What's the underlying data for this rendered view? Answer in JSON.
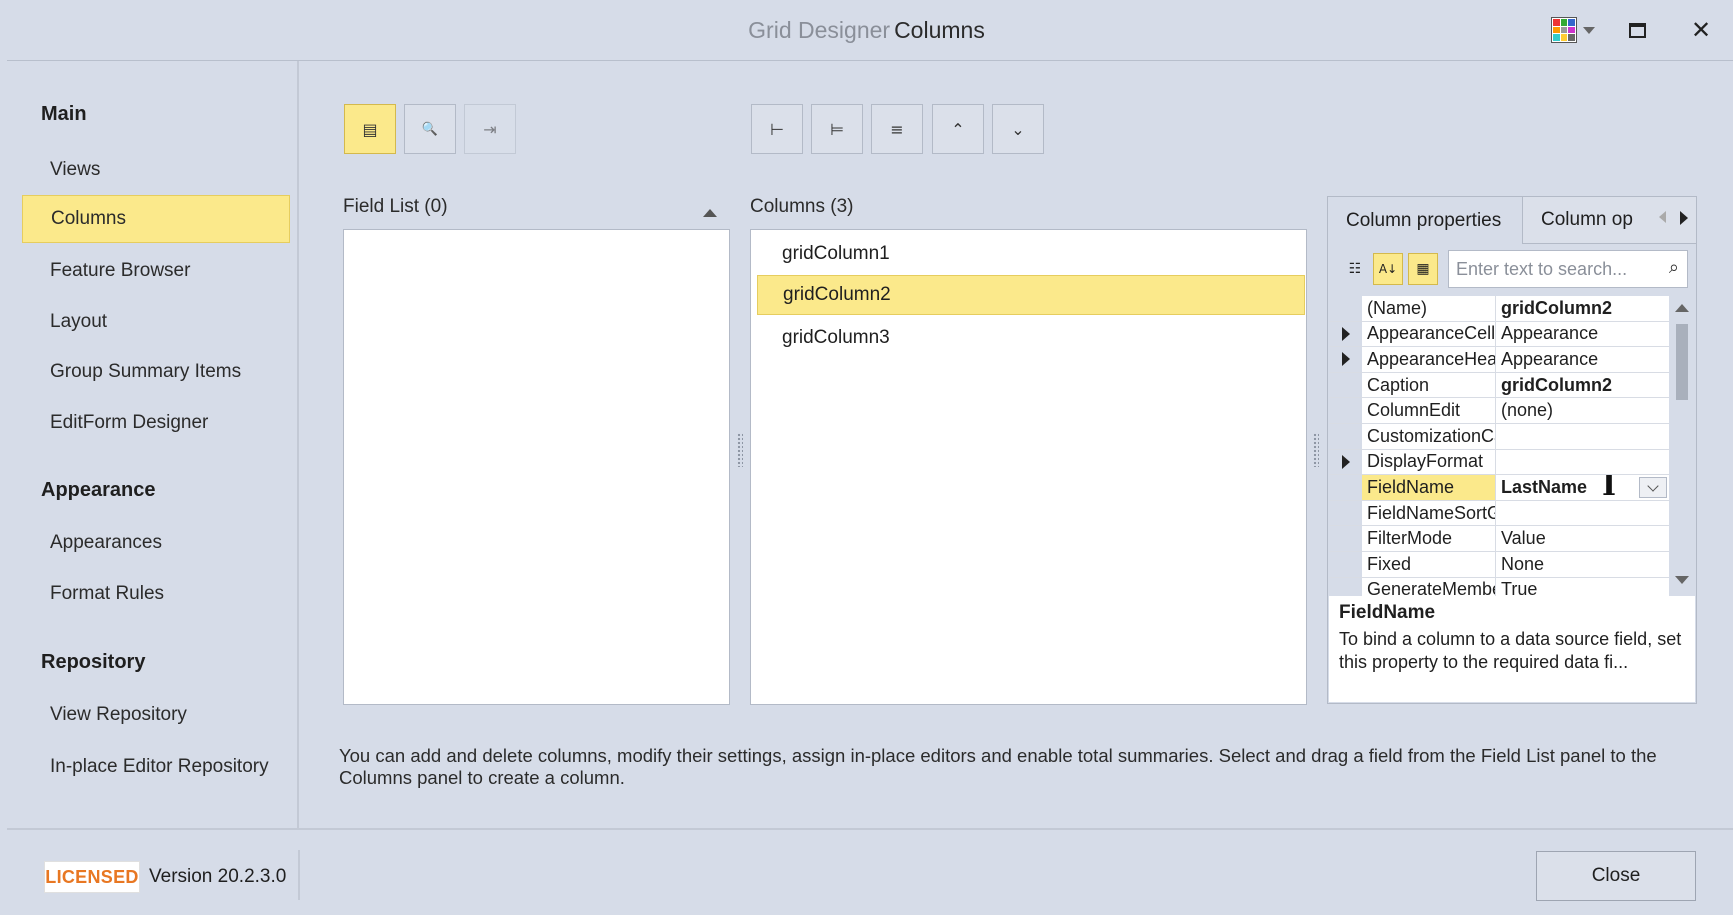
{
  "window": {
    "title_prefix": "Grid Designer",
    "title_page": "Columns",
    "controls": {
      "skin_icon": "skin-palette-icon",
      "maximize_icon": "maximize-icon",
      "close_label": "✕"
    }
  },
  "sidebar": {
    "groups": [
      {
        "label": "Main",
        "items": [
          "Views",
          "Columns",
          "Feature Browser",
          "Layout",
          "Group Summary Items",
          "EditForm Designer"
        ]
      },
      {
        "label": "Appearance",
        "items": [
          "Appearances",
          "Format Rules"
        ]
      },
      {
        "label": "Repository",
        "items": [
          "View Repository",
          "In-place Editor Repository"
        ]
      }
    ],
    "active_item": "Columns"
  },
  "toolbar": {
    "left_buttons": [
      {
        "name": "show-field-list",
        "icon": "field-list-icon",
        "glyph": "▤"
      },
      {
        "name": "find-fields",
        "icon": "search-icon",
        "glyph": "🔍"
      },
      {
        "name": "retrieve-fields",
        "icon": "retrieve-fields-icon",
        "glyph": "⇥"
      }
    ],
    "right_buttons": [
      {
        "name": "add-column",
        "icon": "add-column-icon",
        "glyph": "⊢"
      },
      {
        "name": "insert-column",
        "icon": "insert-column-icon",
        "glyph": "⊨"
      },
      {
        "name": "remove-column",
        "icon": "remove-column-icon",
        "glyph": "≡"
      },
      {
        "name": "move-up",
        "icon": "chevron-up-icon",
        "glyph": "⌃"
      },
      {
        "name": "move-down",
        "icon": "chevron-down-icon",
        "glyph": "⌄"
      }
    ]
  },
  "field_list": {
    "title": "Field List (0)",
    "items": []
  },
  "columns": {
    "title": "Columns (3)",
    "items": [
      "gridColumn1",
      "gridColumn2",
      "gridColumn3"
    ],
    "selected": "gridColumn2"
  },
  "properties": {
    "tabs": [
      "Column properties",
      "Column op"
    ],
    "search_placeholder": "Enter text to search...",
    "rows": [
      {
        "name": "(Name)",
        "value": "gridColumn2",
        "bold": true,
        "expandable": false
      },
      {
        "name": "AppearanceCell",
        "value": "Appearance",
        "bold": false,
        "expandable": true
      },
      {
        "name": "AppearanceHeader",
        "value": "Appearance",
        "bold": false,
        "expandable": true
      },
      {
        "name": "Caption",
        "value": "gridColumn2",
        "bold": true,
        "expandable": false
      },
      {
        "name": "ColumnEdit",
        "value": "(none)",
        "bold": false,
        "expandable": false
      },
      {
        "name": "CustomizationCaption",
        "value": "",
        "bold": false,
        "expandable": false
      },
      {
        "name": "DisplayFormat",
        "value": "",
        "bold": false,
        "expandable": true
      },
      {
        "name": "FieldName",
        "value": "LastName",
        "bold": true,
        "expandable": false,
        "selected": true
      },
      {
        "name": "FieldNameSortGroup",
        "value": "",
        "bold": false,
        "expandable": false
      },
      {
        "name": "FilterMode",
        "value": "Value",
        "bold": false,
        "expandable": false
      },
      {
        "name": "Fixed",
        "value": "None",
        "bold": false,
        "expandable": false
      },
      {
        "name": "GenerateMember",
        "value": "True",
        "bold": false,
        "expandable": false
      }
    ],
    "description": {
      "title": "FieldName",
      "text": "To bind a column to a data source field, set this property to the required data fi..."
    }
  },
  "hint_text": "You can add and delete columns, modify their settings, assign in-place editors and enable total summaries. Select and drag a field from the Field List panel to the Columns panel to create a column.",
  "footer": {
    "license_badge": "LICENSED",
    "version": "Version 20.2.3.0",
    "close_label": "Close"
  },
  "colors": {
    "accent_selected": "#fbe98b",
    "window_bg": "#d6dce8",
    "license_orange": "#e87722"
  }
}
